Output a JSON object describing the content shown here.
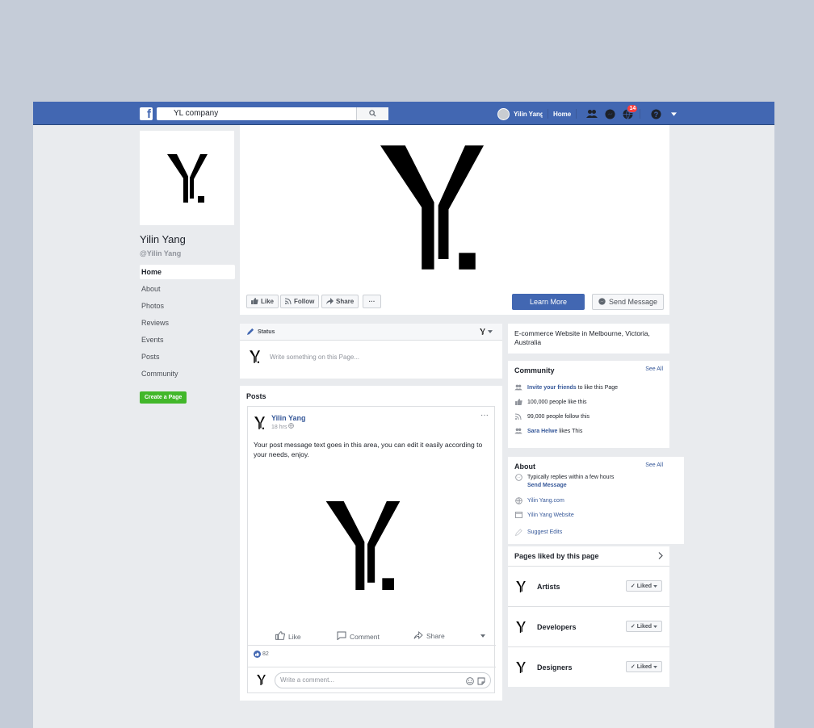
{
  "topbar": {
    "search_value": "YL company",
    "user_name": "Yilin Yang",
    "home_label": "Home",
    "notification_count": "14"
  },
  "sidebar": {
    "page_name": "Yilin Yang",
    "handle": "@Yilin Yang",
    "items": [
      {
        "label": "Home",
        "active": true
      },
      {
        "label": "About"
      },
      {
        "label": "Photos"
      },
      {
        "label": "Reviews"
      },
      {
        "label": "Events"
      },
      {
        "label": "Posts"
      },
      {
        "label": "Community"
      }
    ],
    "create_page_label": "Create a Page"
  },
  "cover_actions": {
    "like": "Like",
    "follow": "Follow",
    "share": "Share",
    "more": "···",
    "learn_more": "Learn More",
    "send_message": "Send Message"
  },
  "status": {
    "header": "Status",
    "placeholder": "Write something on this Page..."
  },
  "posts": {
    "title": "Posts",
    "author": "Yilin Yang",
    "time": "18 hrs",
    "text": "Your post message text goes in this area, you can edit it easily according to your needs, enjoy.",
    "like_label": "Like",
    "comment_label": "Comment",
    "share_label": "Share",
    "reaction_count": "82",
    "comment_placeholder": "Write a comment..."
  },
  "about_short": {
    "text": "E-commerce Website in Melbourne, Victoria, Australia"
  },
  "community": {
    "title": "Community",
    "see_all": "See All",
    "invite_link": "Invite your friends",
    "invite_suffix": " to like this Page",
    "likes": "100,000 people like this",
    "follows": "99,000 people follow this",
    "friend_name": "Sara Helwe",
    "friend_suffix": " likes This"
  },
  "about": {
    "title": "About",
    "see_all": "See All",
    "replies": "Typically replies within a few hours",
    "send_message": "Send Message",
    "website": "Yilin Yang.com",
    "website2": "Yilin Yang Website",
    "suggest": "Suggest Edits"
  },
  "pages_liked": {
    "title": "Pages liked by this page",
    "items": [
      {
        "name": "Artists",
        "button": "Liked"
      },
      {
        "name": "Developers",
        "button": "Liked"
      },
      {
        "name": "Designers",
        "button": "Liked"
      }
    ]
  },
  "colors": {
    "brand_blue": "#4267b2",
    "create_green": "#42b72a",
    "page_bg": "#e9ebee",
    "outer_bg": "#c5ccd8"
  },
  "icons": [
    "facebook-logo-icon",
    "search-icon",
    "friends-icon",
    "messenger-icon",
    "globe-icon",
    "help-icon",
    "caret-down-icon",
    "thumbs-up-icon",
    "rss-icon",
    "share-arrow-icon",
    "pencil-icon",
    "comment-icon",
    "emoji-icon",
    "sticker-icon",
    "chevron-right-icon",
    "check-icon"
  ]
}
